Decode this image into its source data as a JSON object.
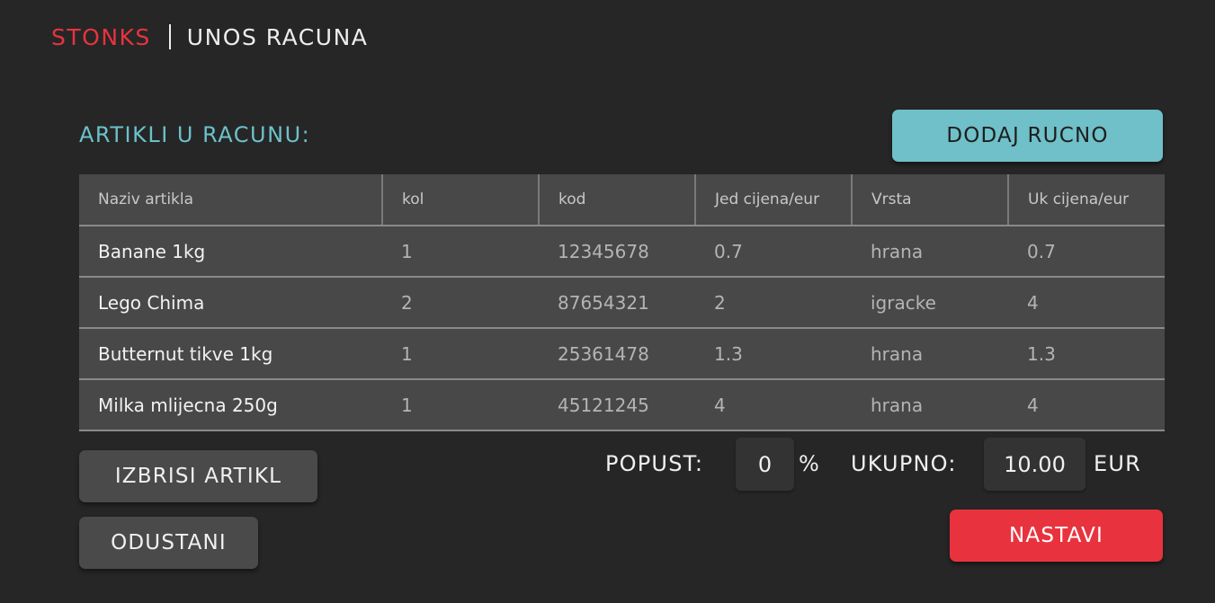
{
  "header": {
    "brand": "STONKS",
    "title": "UNOS RACUNA"
  },
  "section": {
    "title": "ARTIKLI U RACUNU:"
  },
  "buttons": {
    "add_manual": "DODAJ RUCNO",
    "delete_item": "IZBRISI ARTIKL",
    "cancel": "ODUSTANI",
    "next": "NASTAVI"
  },
  "table": {
    "columns": [
      "Naziv artikla",
      "kol",
      "kod",
      "Jed cijena/eur",
      "Vrsta",
      "Uk cijena/eur"
    ],
    "rows": [
      [
        "Banane 1kg",
        "1",
        "12345678",
        "0.7",
        "hrana",
        "0.7"
      ],
      [
        "Lego Chima",
        "2",
        "87654321",
        "2",
        "igracke",
        "4"
      ],
      [
        "Butternut tikve 1kg",
        "1",
        "25361478",
        "1.3",
        "hrana",
        "1.3"
      ],
      [
        "Milka mlijecna 250g",
        "1",
        "45121245",
        "4",
        "hrana",
        "4"
      ]
    ]
  },
  "summary": {
    "discount_label": "POPUST:",
    "discount_value": "0",
    "discount_unit": "%",
    "total_label": "UKUPNO:",
    "total_value": "10.00",
    "currency": "EUR"
  },
  "colors": {
    "background": "#262626",
    "brand_red": "#e8333f",
    "accent_teal": "#6fc0c8",
    "table_bg": "#484848",
    "button_gray": "#4a4a4a"
  }
}
